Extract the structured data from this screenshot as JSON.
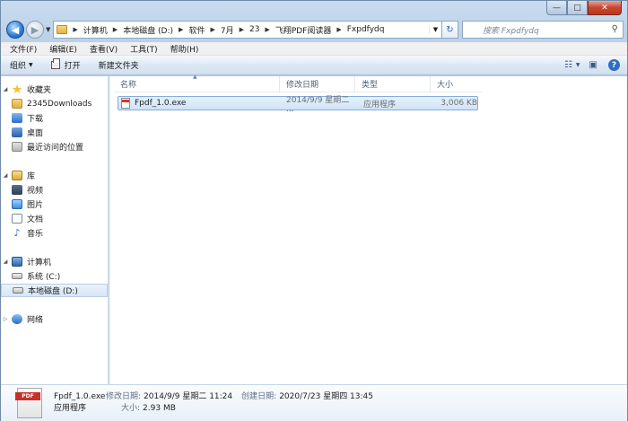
{
  "window": {
    "caption": {
      "minimize": "—",
      "maximize": "□",
      "close": "✕"
    }
  },
  "address": {
    "crumbs": [
      "计算机",
      "本地磁盘 (D:)",
      "软件",
      "7月",
      "23",
      "飞翔PDF阅读器",
      "Fxpdfydq"
    ],
    "search_placeholder": "搜索 Fxpdfydq"
  },
  "menu": [
    "文件(F)",
    "编辑(E)",
    "查看(V)",
    "工具(T)",
    "帮助(H)"
  ],
  "toolbar": {
    "organize": "组织",
    "open": "打开",
    "new_folder": "新建文件夹"
  },
  "nav": {
    "favorites": "收藏夹",
    "fav_items": [
      "2345Downloads",
      "下载",
      "桌面",
      "最近访问的位置"
    ],
    "libraries": "库",
    "lib_items": [
      "视频",
      "图片",
      "文档",
      "音乐"
    ],
    "computer": "计算机",
    "drives": [
      "系统 (C:)",
      "本地磁盘 (D:)"
    ],
    "network": "网络"
  },
  "columns": {
    "name": "名称",
    "date": "修改日期",
    "type": "类型",
    "size": "大小"
  },
  "files": [
    {
      "name": "Fpdf_1.0.exe",
      "date": "2014/9/9 星期二 ...",
      "type": "应用程序",
      "size": "3,006 KB"
    }
  ],
  "details": {
    "icon_text": "PDF",
    "name": "Fpdf_1.0.exe",
    "modified_label": "修改日期:",
    "modified_value": "2014/9/9 星期二 11:24",
    "created_label": "创建日期:",
    "created_value": "2020/7/23 星期四 13:45",
    "type": "应用程序",
    "size_label": "大小:",
    "size_value": "2.93 MB"
  }
}
